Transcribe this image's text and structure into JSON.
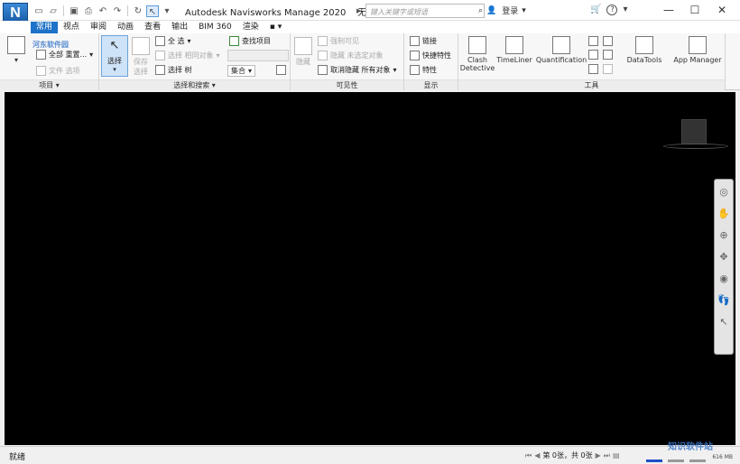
{
  "app": {
    "logo": "N",
    "title": "Autodesk Navisworks Manage 2020",
    "doc": "无...",
    "search_placeholder": "键入关键字或短语",
    "login": "登录"
  },
  "tabs": [
    "常用",
    "视点",
    "审阅",
    "动画",
    "查看",
    "输出",
    "BIM 360",
    "渲染"
  ],
  "ribbon": {
    "project": {
      "label": "项目",
      "reset_all": "全部 重置...",
      "file_options": "文件 选项"
    },
    "select_search": {
      "label": "选择和搜索",
      "select": "选择",
      "save_select": "保存\n选择",
      "select_all": "全 选",
      "select_same": "选择 相同对象",
      "select_tree": "选择 树",
      "find_items": "查找项目",
      "sets": "集合"
    },
    "visibility": {
      "label": "可见性",
      "hide": "隐藏",
      "require_visible": "强制可见",
      "hide_unselected": "隐藏 未选定对象",
      "unhide_all": "取消隐藏 所有对象"
    },
    "display": {
      "label": "显示",
      "links": "链接",
      "quick_props": "快捷特性",
      "properties": "特性"
    },
    "tools": {
      "label": "工具",
      "clash_detective": "Clash\nDetective",
      "timeliner": "TimeLiner",
      "quantification": "Quantification",
      "datatools": "DataTools",
      "app_manager": "App Manager"
    }
  },
  "status": {
    "ready": "就绪",
    "page": "第 0张，共 0张",
    "mem": "616 MB"
  },
  "watermark": {
    "top": "河东软件园",
    "bottom": "知识软件站"
  },
  "colors": {
    "active_tab": "#1e72c8",
    "viewport": "#000000",
    "accent": "#3b8ad8"
  }
}
